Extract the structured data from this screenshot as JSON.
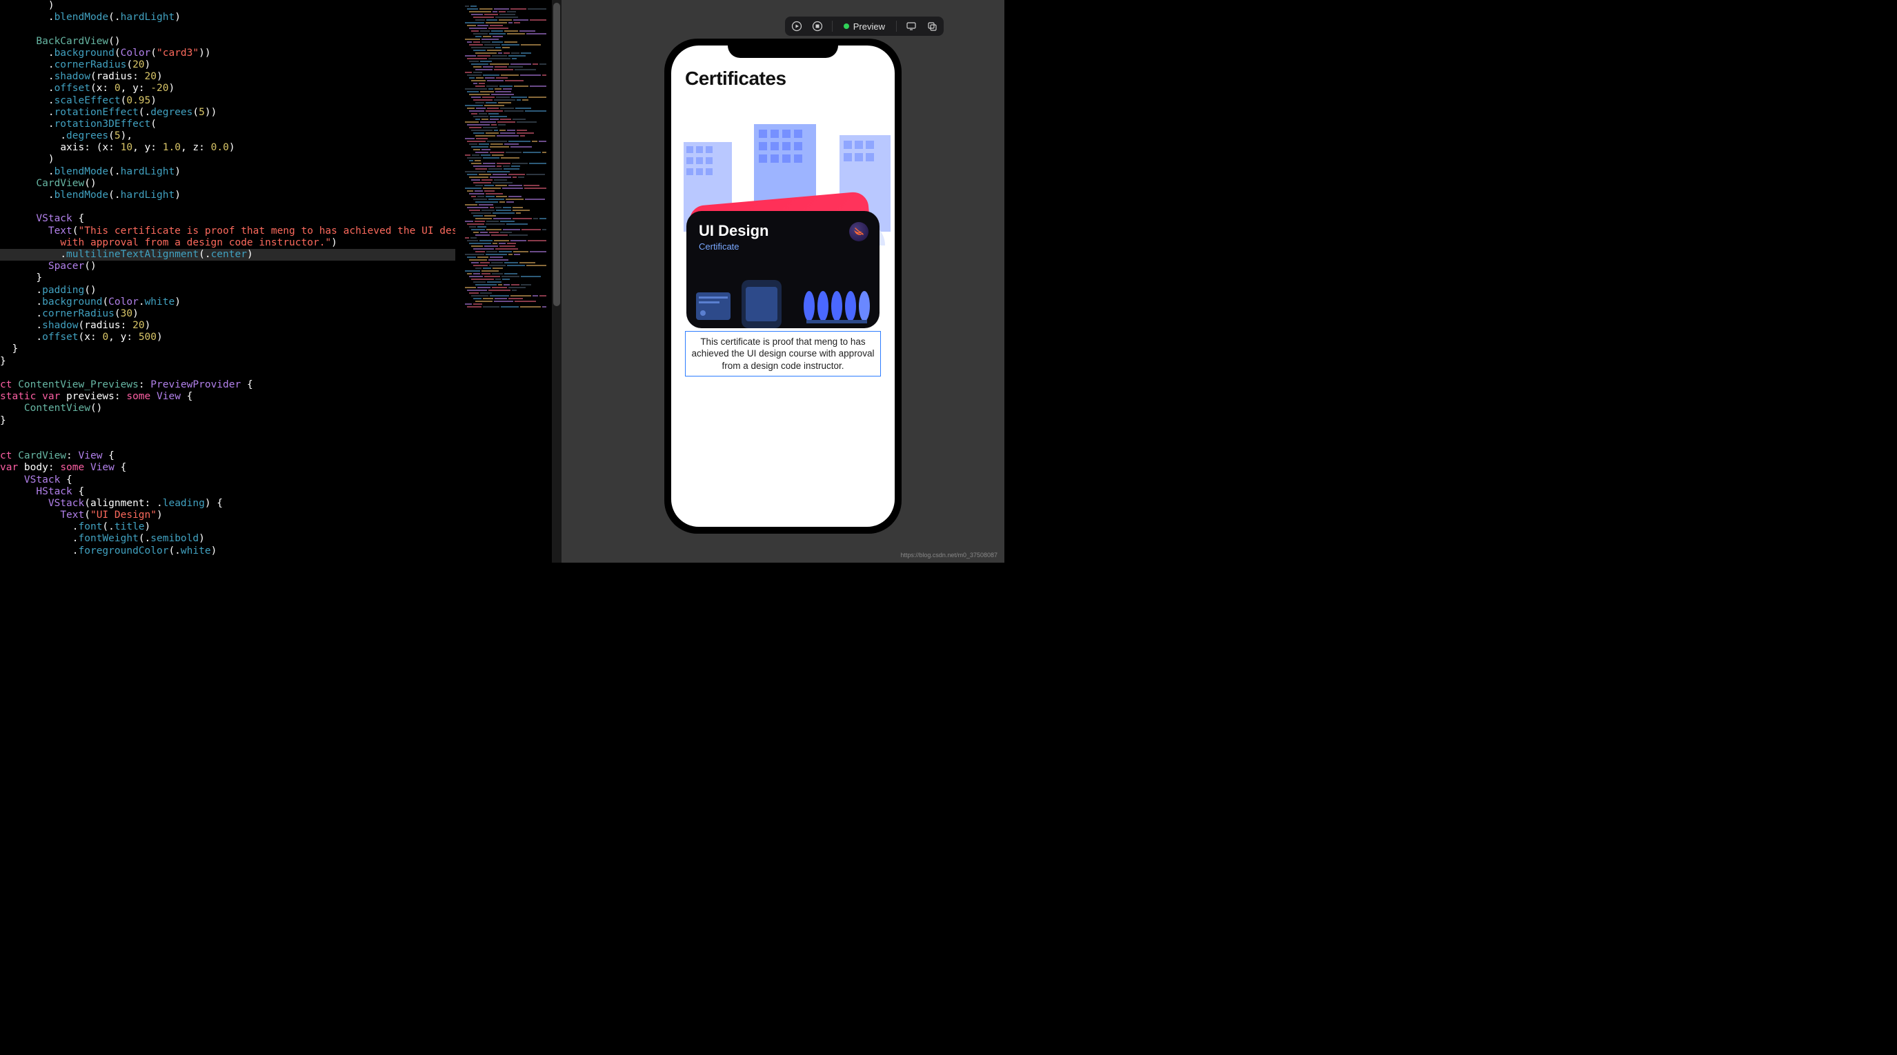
{
  "editor": {
    "tokens": [
      [
        [
          "        ",
          0
        ],
        [
          ")",
          0
        ]
      ],
      [
        [
          "        ",
          0
        ],
        [
          ".",
          0
        ],
        [
          "blendMode",
          3
        ],
        [
          "(.",
          0
        ],
        [
          "hardLight",
          3
        ],
        [
          ")",
          0
        ]
      ],
      [],
      [
        [
          "      ",
          0
        ],
        [
          "BackCardView",
          4
        ],
        [
          "()",
          0
        ]
      ],
      [
        [
          "        ",
          0
        ],
        [
          ".",
          0
        ],
        [
          "background",
          3
        ],
        [
          "(",
          0
        ],
        [
          "Color",
          5
        ],
        [
          "(",
          0
        ],
        [
          "\"card3\"",
          6
        ],
        [
          "))",
          0
        ]
      ],
      [
        [
          "        ",
          0
        ],
        [
          ".",
          0
        ],
        [
          "cornerRadius",
          3
        ],
        [
          "(",
          0
        ],
        [
          "20",
          7
        ],
        [
          ")",
          0
        ]
      ],
      [
        [
          "        ",
          0
        ],
        [
          ".",
          0
        ],
        [
          "shadow",
          3
        ],
        [
          "(radius: ",
          0
        ],
        [
          "20",
          7
        ],
        [
          ")",
          0
        ]
      ],
      [
        [
          "        ",
          0
        ],
        [
          ".",
          0
        ],
        [
          "offset",
          3
        ],
        [
          "(x: ",
          0
        ],
        [
          "0",
          7
        ],
        [
          ", y: ",
          0
        ],
        [
          "-20",
          7
        ],
        [
          ")",
          0
        ]
      ],
      [
        [
          "        ",
          0
        ],
        [
          ".",
          0
        ],
        [
          "scaleEffect",
          3
        ],
        [
          "(",
          0
        ],
        [
          "0.95",
          7
        ],
        [
          ")",
          0
        ]
      ],
      [
        [
          "        ",
          0
        ],
        [
          ".",
          0
        ],
        [
          "rotationEffect",
          3
        ],
        [
          "(.",
          0
        ],
        [
          "degrees",
          3
        ],
        [
          "(",
          0
        ],
        [
          "5",
          7
        ],
        [
          "))",
          0
        ]
      ],
      [
        [
          "        ",
          0
        ],
        [
          ".",
          0
        ],
        [
          "rotation3DEffect",
          3
        ],
        [
          "(",
          0
        ]
      ],
      [
        [
          "          ",
          0
        ],
        [
          ".",
          0
        ],
        [
          "degrees",
          3
        ],
        [
          "(",
          0
        ],
        [
          "5",
          7
        ],
        [
          "),",
          0
        ]
      ],
      [
        [
          "          ",
          0
        ],
        [
          "axis: (x: ",
          0
        ],
        [
          "10",
          7
        ],
        [
          ", y: ",
          0
        ],
        [
          "1.0",
          7
        ],
        [
          ", z: ",
          0
        ],
        [
          "0.0",
          7
        ],
        [
          ")",
          0
        ]
      ],
      [
        [
          "        ",
          0
        ],
        [
          ")",
          0
        ]
      ],
      [
        [
          "        ",
          0
        ],
        [
          ".",
          0
        ],
        [
          "blendMode",
          3
        ],
        [
          "(.",
          0
        ],
        [
          "hardLight",
          3
        ],
        [
          ")",
          0
        ]
      ],
      [
        [
          "      ",
          0
        ],
        [
          "CardView",
          4
        ],
        [
          "()",
          0
        ]
      ],
      [
        [
          "        ",
          0
        ],
        [
          ".",
          0
        ],
        [
          "blendMode",
          3
        ],
        [
          "(.",
          0
        ],
        [
          "hardLight",
          3
        ],
        [
          ")",
          0
        ]
      ],
      [],
      [
        [
          "      ",
          0
        ],
        [
          "VStack",
          5
        ],
        [
          " {",
          0
        ]
      ],
      [
        [
          "        ",
          0
        ],
        [
          "Text",
          5
        ],
        [
          "(",
          0
        ],
        [
          "\"This certificate is proof that meng to has achieved the UI design course",
          6
        ]
      ],
      [
        [
          "          ",
          0
        ],
        [
          "with approval from a design code instructor.\"",
          6
        ],
        [
          ")",
          0
        ]
      ],
      [
        [
          "          ",
          0
        ],
        [
          ".",
          0
        ],
        [
          "multilineTextAlignment",
          3
        ],
        [
          "(.",
          0
        ],
        [
          "center",
          3
        ],
        [
          ")",
          0
        ]
      ],
      [
        [
          "        ",
          0
        ],
        [
          "Spacer",
          5
        ],
        [
          "()",
          0
        ]
      ],
      [
        [
          "      ",
          0
        ],
        [
          "}",
          0
        ]
      ],
      [
        [
          "      ",
          0
        ],
        [
          ".",
          0
        ],
        [
          "padding",
          3
        ],
        [
          "()",
          0
        ]
      ],
      [
        [
          "      ",
          0
        ],
        [
          ".",
          0
        ],
        [
          "background",
          3
        ],
        [
          "(",
          0
        ],
        [
          "Color",
          5
        ],
        [
          ".",
          0
        ],
        [
          "white",
          3
        ],
        [
          ")",
          0
        ]
      ],
      [
        [
          "      ",
          0
        ],
        [
          ".",
          0
        ],
        [
          "cornerRadius",
          3
        ],
        [
          "(",
          0
        ],
        [
          "30",
          7
        ],
        [
          ")",
          0
        ]
      ],
      [
        [
          "      ",
          0
        ],
        [
          ".",
          0
        ],
        [
          "shadow",
          3
        ],
        [
          "(radius: ",
          0
        ],
        [
          "20",
          7
        ],
        [
          ")",
          0
        ]
      ],
      [
        [
          "      ",
          0
        ],
        [
          ".",
          0
        ],
        [
          "offset",
          3
        ],
        [
          "(x: ",
          0
        ],
        [
          "0",
          7
        ],
        [
          ", y: ",
          0
        ],
        [
          "500",
          7
        ],
        [
          ")",
          0
        ]
      ],
      [
        [
          "  ",
          0
        ],
        [
          "}",
          0
        ]
      ],
      [
        [
          "}",
          0
        ]
      ],
      [],
      [
        [
          "ct ",
          8
        ],
        [
          "ContentView_Previews",
          4
        ],
        [
          ": ",
          0
        ],
        [
          "PreviewProvider",
          5
        ],
        [
          " {",
          0
        ]
      ],
      [
        [
          "static var",
          8
        ],
        [
          " previews: ",
          0
        ],
        [
          "some",
          8
        ],
        [
          " ",
          0
        ],
        [
          "View",
          5
        ],
        [
          " {",
          0
        ]
      ],
      [
        [
          "    ",
          0
        ],
        [
          "ContentView",
          4
        ],
        [
          "()",
          0
        ]
      ],
      [
        [
          "}",
          0
        ]
      ],
      [],
      [],
      [
        [
          "ct ",
          8
        ],
        [
          "CardView",
          4
        ],
        [
          ": ",
          0
        ],
        [
          "View",
          5
        ],
        [
          " {",
          0
        ]
      ],
      [
        [
          "var",
          8
        ],
        [
          " body: ",
          0
        ],
        [
          "some",
          8
        ],
        [
          " ",
          0
        ],
        [
          "View",
          5
        ],
        [
          " {",
          0
        ]
      ],
      [
        [
          "    ",
          0
        ],
        [
          "VStack",
          5
        ],
        [
          " {",
          0
        ]
      ],
      [
        [
          "      ",
          0
        ],
        [
          "HStack",
          5
        ],
        [
          " {",
          0
        ]
      ],
      [
        [
          "        ",
          0
        ],
        [
          "VStack",
          5
        ],
        [
          "(alignment: .",
          0
        ],
        [
          "leading",
          3
        ],
        [
          ") {",
          0
        ]
      ],
      [
        [
          "          ",
          0
        ],
        [
          "Text",
          5
        ],
        [
          "(",
          0
        ],
        [
          "\"UI Design\"",
          6
        ],
        [
          ")",
          0
        ]
      ],
      [
        [
          "            ",
          0
        ],
        [
          ".",
          0
        ],
        [
          "font",
          3
        ],
        [
          "(.",
          0
        ],
        [
          "title",
          3
        ],
        [
          ")",
          0
        ]
      ],
      [
        [
          "            ",
          0
        ],
        [
          ".",
          0
        ],
        [
          "fontWeight",
          3
        ],
        [
          "(.",
          0
        ],
        [
          "semibold",
          3
        ],
        [
          ")",
          0
        ]
      ],
      [
        [
          "            ",
          0
        ],
        [
          ".",
          0
        ],
        [
          "foregroundColor",
          3
        ],
        [
          "(.",
          0
        ],
        [
          "white",
          3
        ],
        [
          ")",
          0
        ]
      ]
    ],
    "highlighted_line_index": 21,
    "color_map": {
      "0": "k-white",
      "3": "k-cyan",
      "4": "k-green",
      "5": "k-purple",
      "6": "k-red",
      "7": "k-yellow",
      "8": "k-pink"
    }
  },
  "preview_toolbar": {
    "label": "Preview"
  },
  "preview_screen": {
    "title": "Certificates",
    "card_title": "UI Design",
    "card_subtitle": "Certificate",
    "description": "This certificate is proof that meng to has achieved the UI design course with approval from a design code instructor."
  },
  "watermark": "https://blog.csdn.net/m0_37508087"
}
